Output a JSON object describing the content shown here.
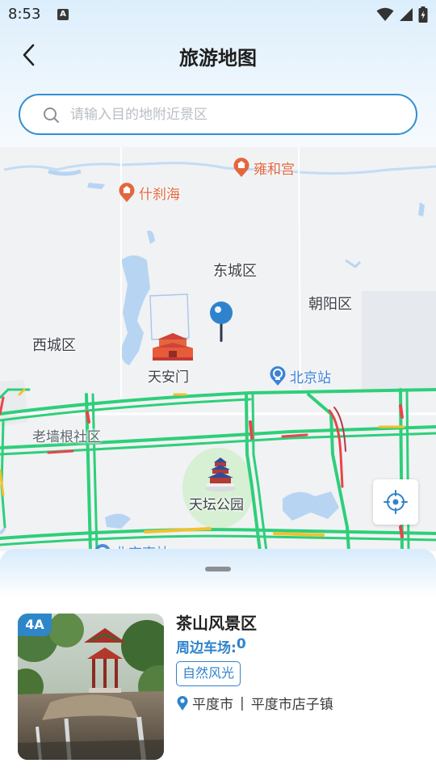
{
  "status_bar": {
    "time": "8:53",
    "notification_letter": "A"
  },
  "header": {
    "title": "旅游地图"
  },
  "search": {
    "placeholder": "请输入目的地附近景区"
  },
  "map": {
    "districts": [
      "东城区",
      "朝阳区",
      "西城区",
      "老墙根社区"
    ],
    "pois": [
      {
        "name": "雍和宫",
        "icon": "temple-pin-icon",
        "color": "#e2673f"
      },
      {
        "name": "什刹海",
        "icon": "temple-pin-icon",
        "color": "#e2673f"
      },
      {
        "name": "北京站",
        "icon": "train-station-pin-icon",
        "color": "#3b83d8"
      }
    ],
    "landmarks": [
      {
        "name": "天安门",
        "icon": "tiananmen-icon"
      },
      {
        "name": "天坛公园",
        "icon": "temple-of-heaven-icon"
      }
    ],
    "partial_label": "北京南站"
  },
  "listing": {
    "level_badge": "4A",
    "name": "茶山风景区",
    "parking_label": "周边车场:",
    "parking_count": "0",
    "tag": "自然风光",
    "city": "平度市",
    "separator": "|",
    "address": "平度市店子镇"
  },
  "colors": {
    "accent": "#2f83cc",
    "poi_orange": "#e2673f",
    "traffic_green": "#2ecf7a",
    "traffic_red": "#e8454a",
    "traffic_yellow": "#f2c12e"
  }
}
